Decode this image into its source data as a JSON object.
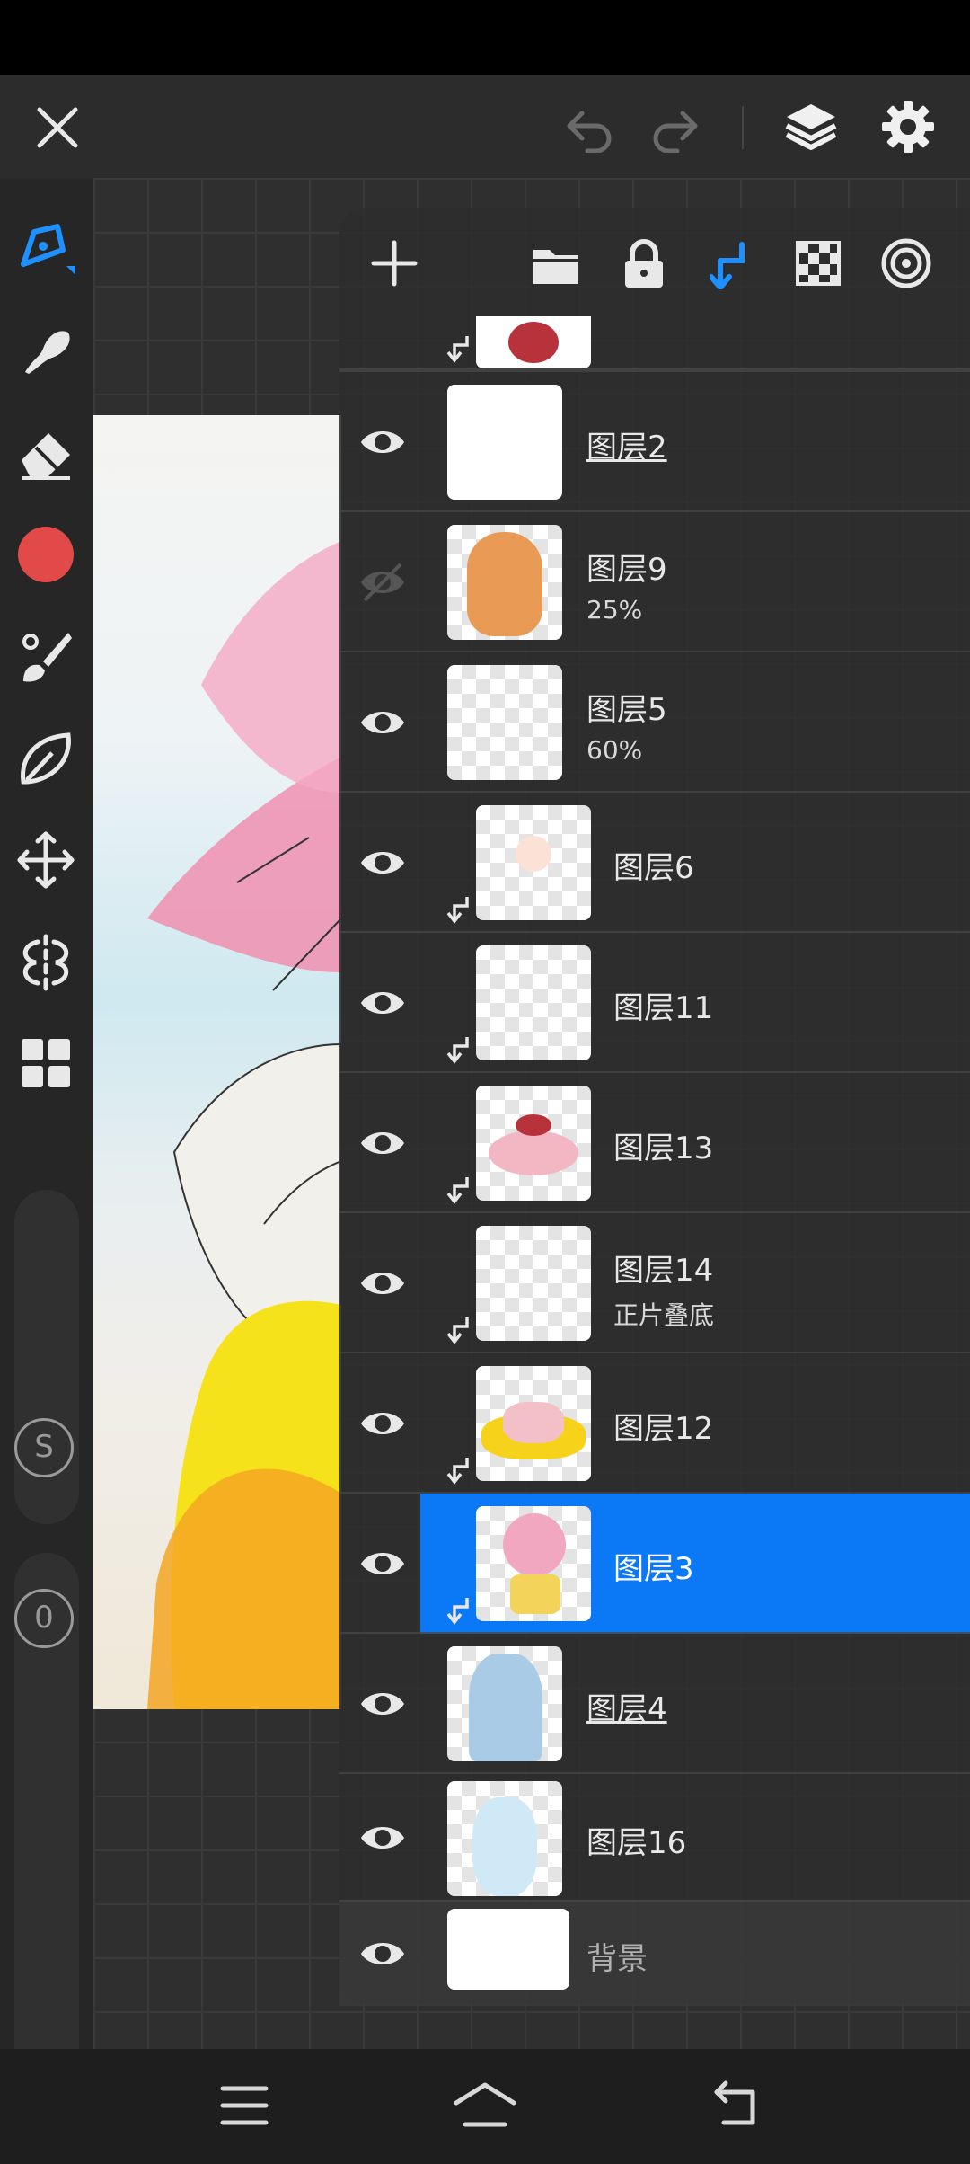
{
  "colors": {
    "accent": "#0b78f5",
    "brush_color": "#e24a4a"
  },
  "top_bar": {
    "icons": [
      "close-icon",
      "undo-icon",
      "redo-icon",
      "layers-icon",
      "settings-icon"
    ]
  },
  "left_toolbar": {
    "tools": [
      "pen-icon",
      "smudge-icon",
      "eraser-icon",
      "color-swatch",
      "brush-icon",
      "lasso-icon",
      "transform-icon",
      "symmetry-icon",
      "grid-icon"
    ],
    "rail_labels": {
      "size": "S",
      "opacity": "0"
    }
  },
  "layers_panel": {
    "toolbar_icons": [
      "add-layer-icon",
      "folder-icon",
      "lock-icon",
      "clip-icon",
      "alpha-lock-icon",
      "target-icon"
    ],
    "layers": [
      {
        "name": "图层2",
        "sub": "",
        "visible": true,
        "clipped": false,
        "underline": true
      },
      {
        "name": "图层9",
        "sub": "25%",
        "visible": false,
        "clipped": false,
        "underline": false
      },
      {
        "name": "图层5",
        "sub": "60%",
        "visible": true,
        "clipped": false,
        "underline": false
      },
      {
        "name": "图层6",
        "sub": "",
        "visible": true,
        "clipped": true,
        "underline": false
      },
      {
        "name": "图层11",
        "sub": "",
        "visible": true,
        "clipped": true,
        "underline": false
      },
      {
        "name": "图层13",
        "sub": "",
        "visible": true,
        "clipped": true,
        "underline": false
      },
      {
        "name": "图层14",
        "sub": "正片叠底",
        "visible": true,
        "clipped": true,
        "underline": false
      },
      {
        "name": "图层12",
        "sub": "",
        "visible": true,
        "clipped": true,
        "underline": false
      },
      {
        "name": "图层3",
        "sub": "",
        "visible": true,
        "clipped": true,
        "underline": false,
        "selected": true
      },
      {
        "name": "图层4",
        "sub": "",
        "visible": true,
        "clipped": false,
        "underline": true
      },
      {
        "name": "图层16",
        "sub": "",
        "visible": true,
        "clipped": false,
        "underline": false
      },
      {
        "name": "背景",
        "sub": "",
        "visible": true,
        "clipped": false,
        "underline": false
      }
    ]
  },
  "nav_bar": {
    "icons": [
      "menu-icon",
      "home-icon",
      "back-icon"
    ]
  }
}
